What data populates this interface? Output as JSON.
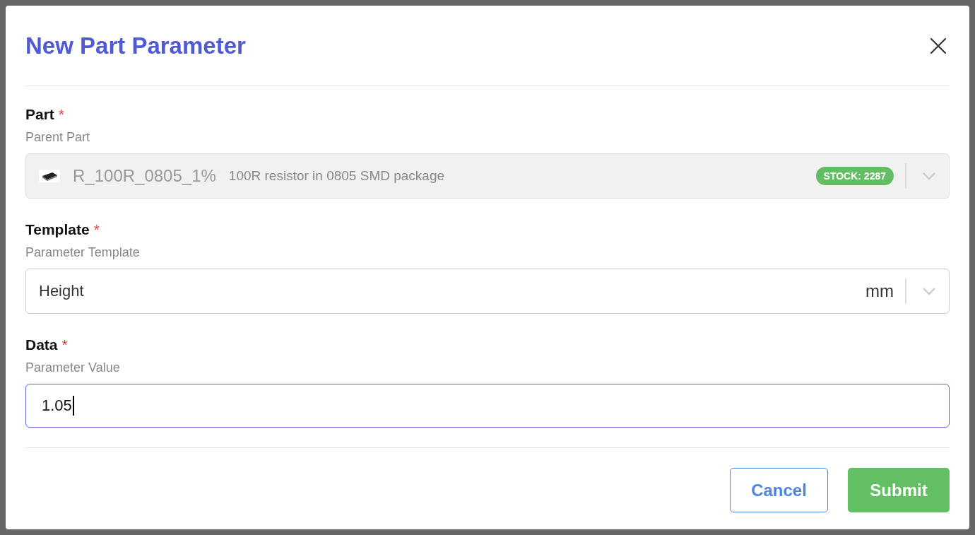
{
  "dialog": {
    "title": "New Part Parameter",
    "fields": [
      {
        "kind": "part-select",
        "label": "Part",
        "required_mark": "*",
        "description": "Parent Part",
        "disabled": true,
        "focused": false,
        "value": "R_100R_0805_1%",
        "detail": "100R resistor in 0805 SMD package",
        "badge": "STOCK: 2287"
      },
      {
        "kind": "select",
        "label": "Template",
        "required_mark": "*",
        "description": "Parameter Template",
        "disabled": false,
        "focused": false,
        "value": "Height",
        "suffix": "mm"
      },
      {
        "kind": "text",
        "label": "Data",
        "required_mark": "*",
        "description": "Parameter Value",
        "disabled": false,
        "focused": true,
        "value": "1.05"
      }
    ],
    "buttons": [
      {
        "label": "Cancel",
        "kind": "outline"
      },
      {
        "label": "Submit",
        "kind": "primary"
      }
    ]
  }
}
